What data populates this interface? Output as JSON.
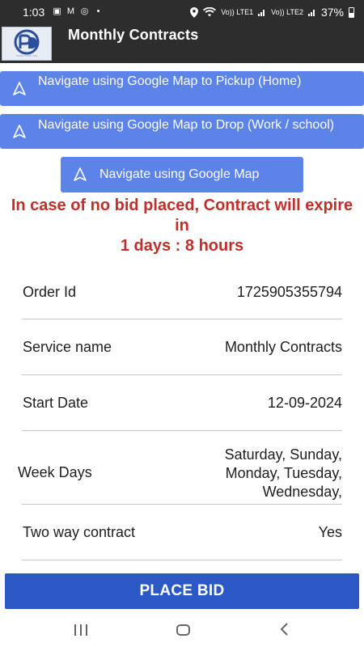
{
  "status_bar": {
    "time": "1:03",
    "battery": "37%",
    "signal_1": "Vo)) LTE1",
    "signal_2": "Vo)) LTE2"
  },
  "app_bar": {
    "title": "Monthly Contracts"
  },
  "navigation": {
    "pickup_label": "Navigate using Google Map to Pickup (Home)",
    "drop_label": "Navigate using Google Map to Drop (Work / school)",
    "map_label": "Navigate using Google Map"
  },
  "expiry": {
    "line1": "In case of no bid placed, Contract will expire in",
    "line2": "1 days : 8 hours"
  },
  "details": [
    {
      "label": "Order Id",
      "value": "1725905355794"
    },
    {
      "label": "Service name",
      "value": "Monthly Contracts"
    },
    {
      "label": "Start Date",
      "value": "12-09-2024"
    },
    {
      "label": "Week Days",
      "value": "Saturday,  Sunday,\nMonday,  Tuesday,\nWednesday, "
    },
    {
      "label": "Two way contract",
      "value": "Yes"
    }
  ],
  "actions": {
    "place_bid_label": "PLACE BID"
  },
  "colors": {
    "accent_blue": "#5b83e8",
    "primary_button": "#2b58c4",
    "warning_red": "#c0302a",
    "app_bar_bg": "#2d2d2d"
  }
}
